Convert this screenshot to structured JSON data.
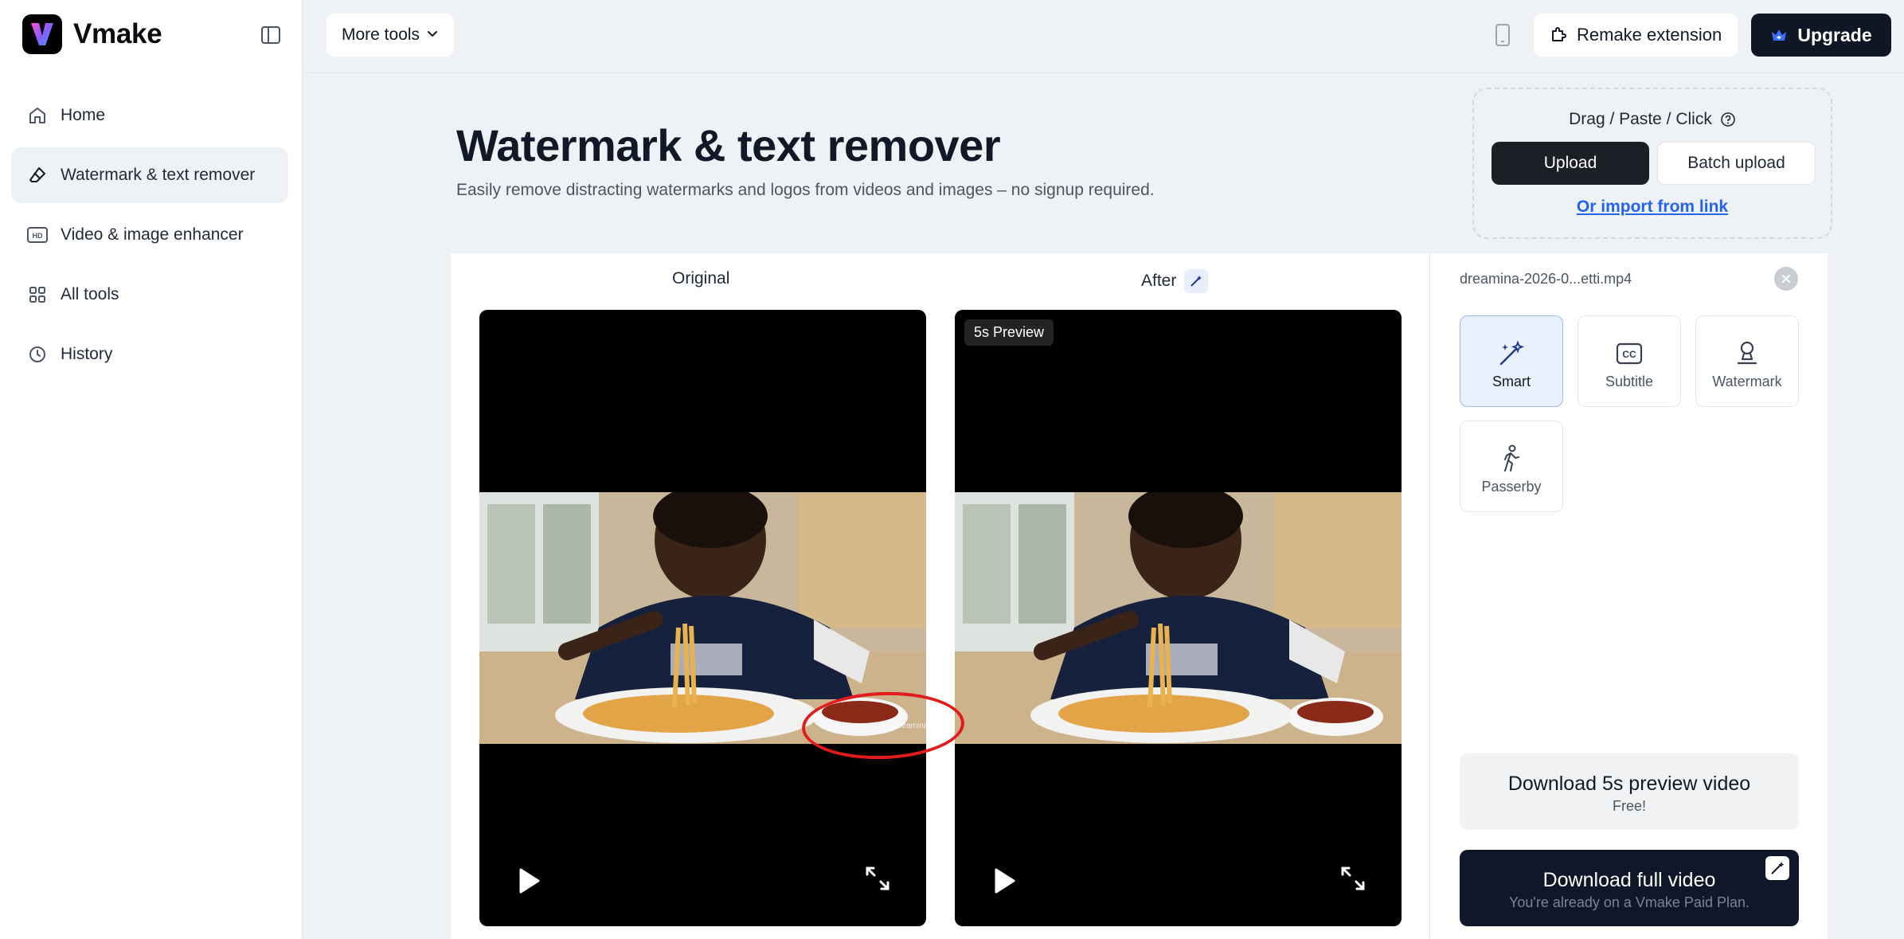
{
  "app": {
    "name": "Vmake"
  },
  "sidebar": {
    "items": [
      {
        "label": "Home",
        "icon": "home-icon",
        "active": false
      },
      {
        "label": "Watermark & text remover",
        "icon": "eraser-icon",
        "active": true
      },
      {
        "label": "Video & image enhancer",
        "icon": "hd-icon",
        "active": false
      },
      {
        "label": "All tools",
        "icon": "grid-icon",
        "active": false
      },
      {
        "label": "History",
        "icon": "clock-icon",
        "active": false
      }
    ]
  },
  "topbar": {
    "more_tools": "More tools",
    "remake_extension": "Remake extension",
    "upgrade": "Upgrade"
  },
  "header": {
    "title": "Watermark & text remover",
    "subtitle": "Easily remove distracting watermarks and logos from videos and images – no signup required."
  },
  "upload": {
    "drag_label": "Drag / Paste / Click",
    "upload": "Upload",
    "batch_upload": "Batch upload",
    "import_link": "Or import from link"
  },
  "compare": {
    "original_label": "Original",
    "after_label": "After",
    "preview_tag": "5s Preview"
  },
  "options": {
    "file_name": "dreamina-2026-0...etti.mp4",
    "modes": [
      {
        "label": "Smart",
        "icon": "magic-wand-icon",
        "selected": true
      },
      {
        "label": "Subtitle",
        "icon": "cc-icon",
        "selected": false
      },
      {
        "label": "Watermark",
        "icon": "person-stamp-icon",
        "selected": false
      },
      {
        "label": "Passerby",
        "icon": "walking-person-icon",
        "selected": false
      }
    ],
    "download_preview": {
      "title": "Download 5s preview video",
      "note": "Free!"
    },
    "download_full": {
      "title": "Download full video",
      "note": "You're already on a Vmake Paid Plan."
    }
  },
  "colors": {
    "accent_dark": "#0f1626",
    "link_blue": "#2563eb",
    "selected_card": "#eaf1fe",
    "annotation_red": "#e21b1b"
  }
}
